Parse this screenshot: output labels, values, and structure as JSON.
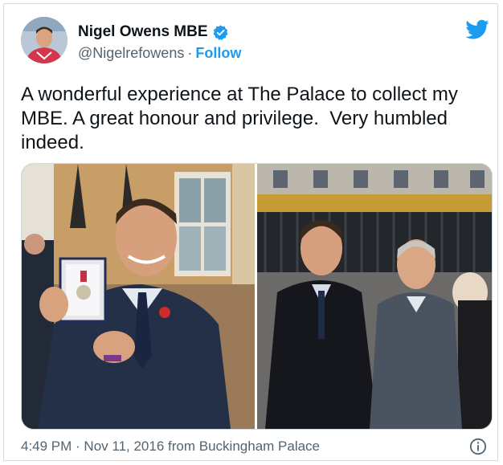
{
  "author": {
    "display_name": "Nigel Owens MBE",
    "handle": "@Nigelrefowens",
    "separator": "·",
    "follow_label": "Follow"
  },
  "tweet": {
    "text": "A wonderful experience at The Palace to collect my\nMBE. A great honour and privilege.  Very humbled\nindeed."
  },
  "meta": {
    "timestamp": "4:49 PM · Nov 11, 2016",
    "source": "from Buckingham Palace"
  },
  "icons": {
    "verified": "verified-badge-icon",
    "brand": "twitter-bird-icon",
    "info": "info-icon"
  },
  "colors": {
    "accent": "#1d9bf0",
    "text": "#0f1419",
    "secondary": "#536471",
    "border": "#cfd9de"
  }
}
